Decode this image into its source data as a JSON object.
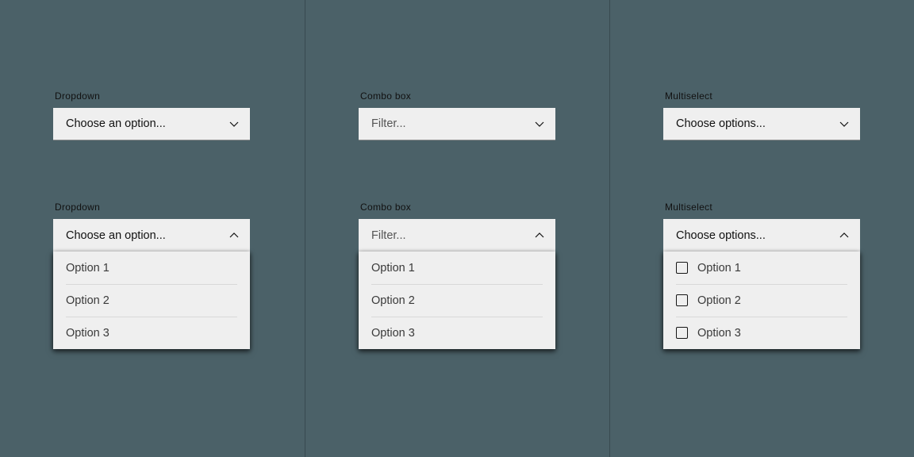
{
  "dropdown": {
    "label": "Dropdown",
    "closed_text": "Choose an option...",
    "open_text": "Choose an option...",
    "options": [
      "Option 1",
      "Option 2",
      "Option 3"
    ]
  },
  "combobox": {
    "label": "Combo box",
    "closed_placeholder": "Filter...",
    "open_placeholder": "Filter...",
    "options": [
      "Option 1",
      "Option 2",
      "Option 3"
    ]
  },
  "multiselect": {
    "label": "Multiselect",
    "closed_text": "Choose options...",
    "open_text": "Choose options...",
    "options": [
      "Option 1",
      "Option 2",
      "Option 3"
    ]
  }
}
